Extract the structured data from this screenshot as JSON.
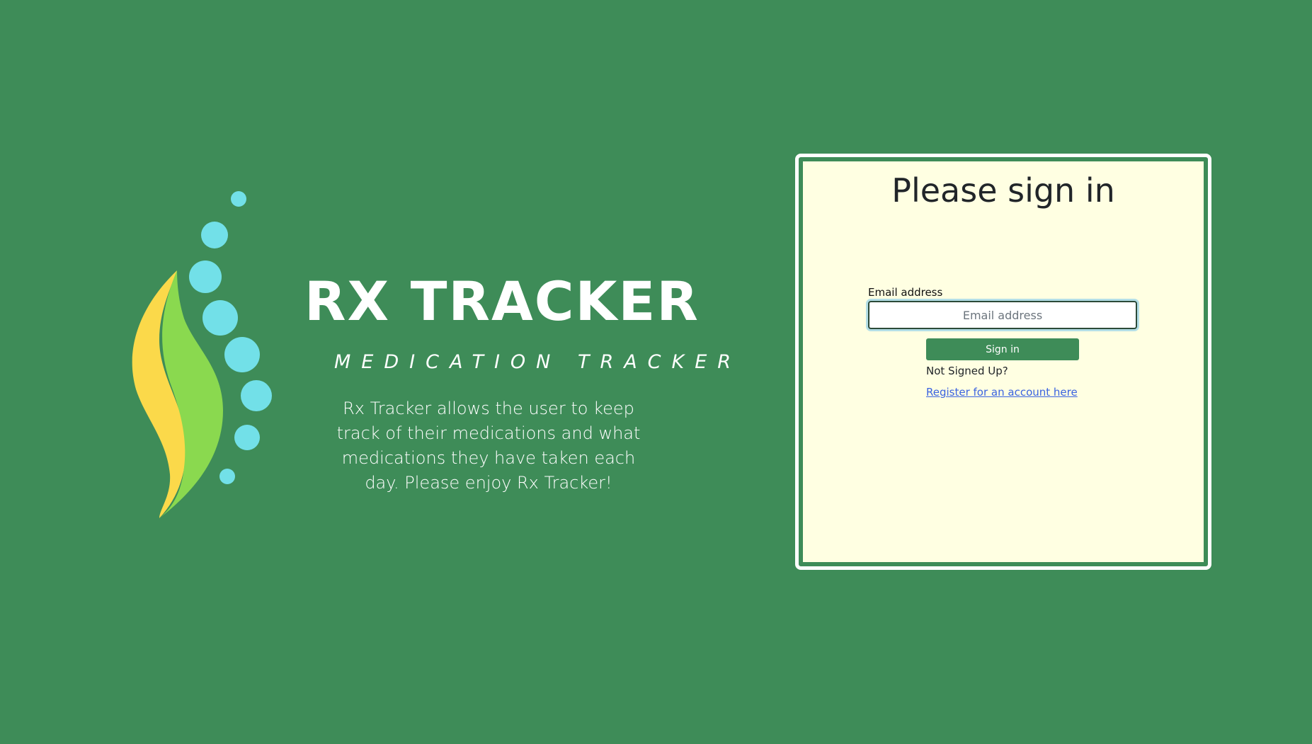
{
  "brand": {
    "title": "RX TRACKER",
    "subtitle": "MEDICATION TRACKER",
    "description": "Rx Tracker allows the user to keep track of their medications and what medications they have taken each day. Please enjoy Rx Tracker!",
    "logo_icon": "leaf-with-bubbles-icon"
  },
  "signin": {
    "heading": "Please sign in",
    "email_label": "Email address",
    "email_placeholder": "Email address",
    "email_value": "",
    "button_label": "Sign in",
    "not_signed_up": "Not Signed Up?",
    "register_link": "Register for an account here"
  },
  "colors": {
    "background": "#3e8c58",
    "card_background": "#ffffe2",
    "button": "#3e8c58",
    "link": "#3b63e0",
    "leaf_yellow": "#fbd94a",
    "leaf_green": "#8ad94f",
    "bubble_cyan": "#72e0e8"
  }
}
